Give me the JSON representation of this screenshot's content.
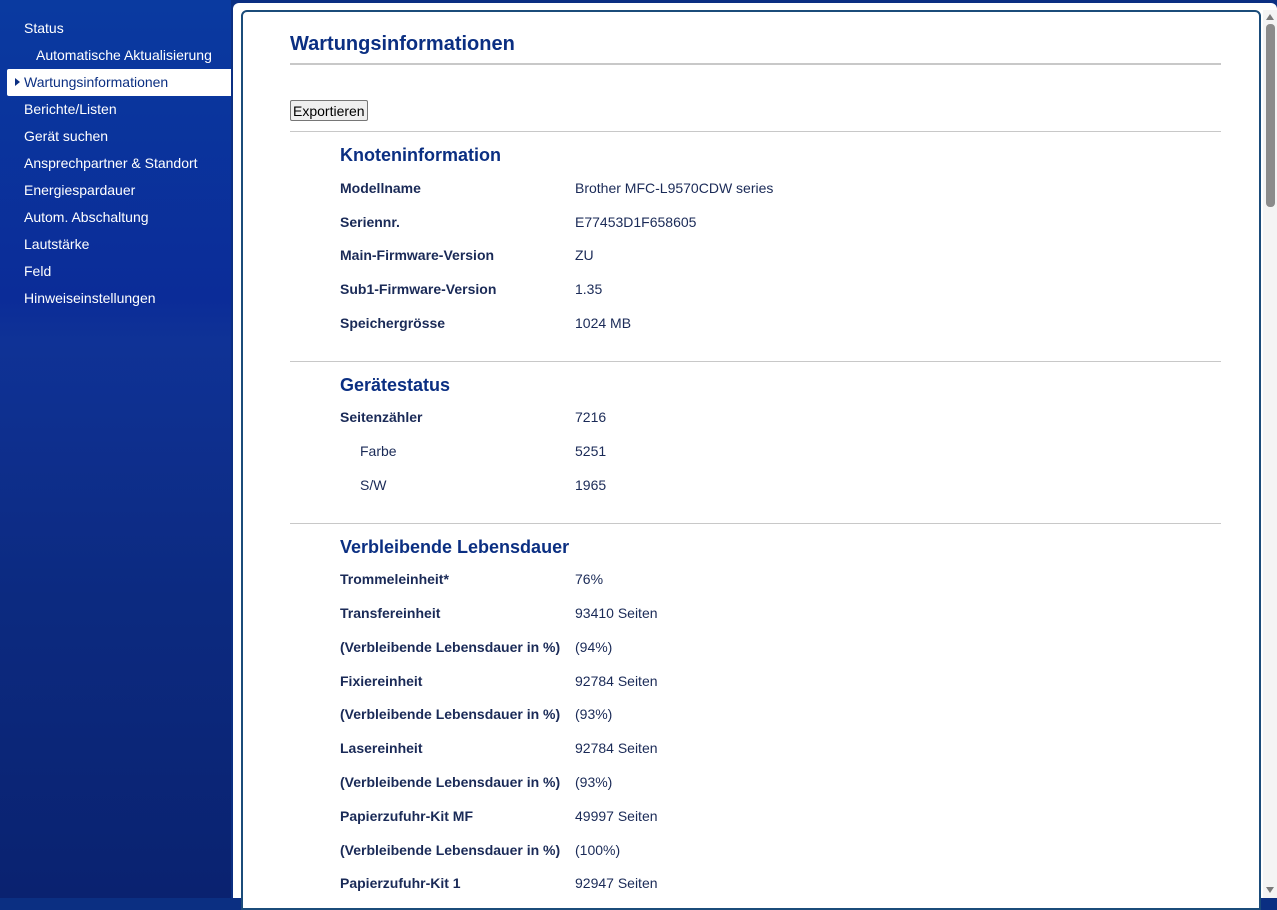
{
  "sidebar": {
    "items": [
      {
        "label": "Status"
      },
      {
        "label": "Automatische Aktualisierung"
      },
      {
        "label": "Wartungsinformationen"
      },
      {
        "label": "Berichte/Listen"
      },
      {
        "label": "Gerät suchen"
      },
      {
        "label": "Ansprechpartner & Standort"
      },
      {
        "label": "Energiespardauer"
      },
      {
        "label": "Autom. Abschaltung"
      },
      {
        "label": "Lautstärke"
      },
      {
        "label": "Feld"
      },
      {
        "label": "Hinweiseinstellungen"
      }
    ],
    "active_index": 2
  },
  "main": {
    "title": "Wartungsinformationen",
    "export_label": "Exportieren",
    "node": {
      "title": "Knoteninformation",
      "rows": [
        {
          "label": "Modellname",
          "value": "Brother MFC-L9570CDW series"
        },
        {
          "label": "Seriennr.",
          "value": "E77453D1F658605"
        },
        {
          "label": "Main-Firmware-Version",
          "value": "ZU"
        },
        {
          "label": "Sub1-Firmware-Version",
          "value": "1.35"
        },
        {
          "label": "Speichergrösse",
          "value": "1024 MB"
        }
      ]
    },
    "status": {
      "title": "Gerätestatus",
      "rows": [
        {
          "label": "Seitenzähler",
          "value": "7216"
        },
        {
          "label": "Farbe",
          "value": "5251"
        },
        {
          "label": "S/W",
          "value": "1965"
        }
      ]
    },
    "life": {
      "title": "Verbleibende Lebensdauer",
      "rows": [
        {
          "label": "Trommeleinheit*",
          "value": "76%"
        },
        {
          "label": "Transfereinheit",
          "value": "93410  Seiten"
        },
        {
          "label": "(Verbleibende Lebensdauer in %)",
          "value": "(94%)"
        },
        {
          "label": "Fixiereinheit",
          "value": "92784  Seiten"
        },
        {
          "label": "(Verbleibende Lebensdauer in %)",
          "value": "(93%)"
        },
        {
          "label": "Lasereinheit",
          "value": "92784  Seiten"
        },
        {
          "label": "(Verbleibende Lebensdauer in %)",
          "value": "(93%)"
        },
        {
          "label": "Papierzufuhr-Kit MF",
          "value": "49997  Seiten"
        },
        {
          "label": "(Verbleibende Lebensdauer in %)",
          "value": "(100%)"
        },
        {
          "label": "Papierzufuhr-Kit 1",
          "value": "92947  Seiten"
        }
      ]
    }
  }
}
